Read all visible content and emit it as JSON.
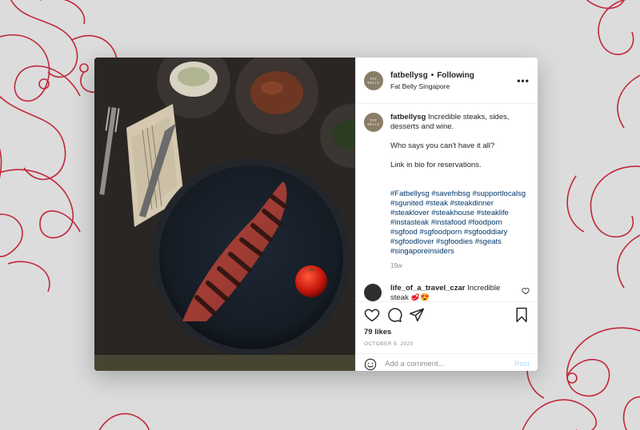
{
  "header": {
    "username": "fatbellysg",
    "separator": "•",
    "follow_status": "Following",
    "location": "Fat Belly Singapore",
    "logo_text": "FAT BELLY"
  },
  "caption": {
    "username": "fatbellysg",
    "line1": "Incredible steaks, sides, desserts and wine.",
    "line2": "Who says you can't have it all?",
    "line3": "Link in bio for reservations.",
    "hashtags": "#Fatbellysg #savefnbsg #supportlocalsg #sgunited #steak #steakdinner #steaklover #steakhouse #steaklife #instasteak #instafood #foodporn #sgfood #sgfoodporn #sgfooddiary #sgfoodlover #sgfoodies #sgeats #singaporeinsiders",
    "time_ago": "19w"
  },
  "comment": {
    "username": "life_of_a_travel_czar",
    "text": "Incredible steak 🥩😍"
  },
  "stats": {
    "likes": "79 likes",
    "date": "OCTOBER 9, 2020"
  },
  "add_comment": {
    "placeholder": "Add a comment...",
    "post_label": "Post"
  },
  "icons": {
    "more": "more-options-icon",
    "like": "heart-icon",
    "comment": "comment-icon",
    "share": "share-icon",
    "save": "bookmark-icon",
    "emoji": "emoji-icon"
  },
  "colors": {
    "background": "#dcdcdc",
    "ornament": "#c0283a",
    "hashtag": "#00376b",
    "post_button": "#b2dffc",
    "logo_bg": "#8a7d68"
  }
}
